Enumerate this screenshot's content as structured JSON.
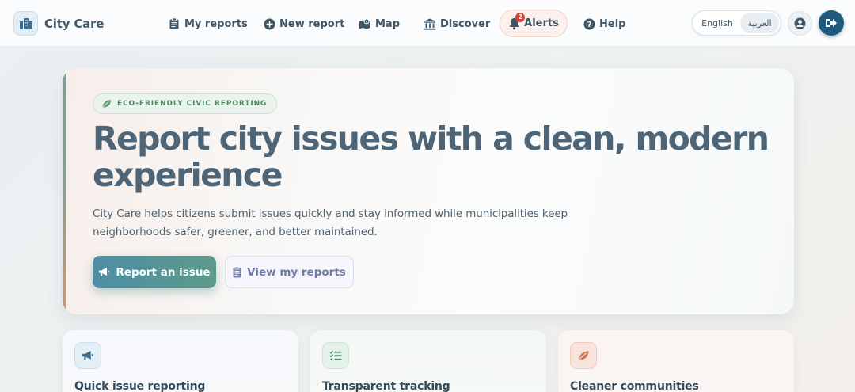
{
  "brand": {
    "name": "City Care",
    "icon": "city-buildings-icon"
  },
  "nav": {
    "links": [
      {
        "label": "My reports",
        "icon": "clipboard-icon"
      },
      {
        "label": "New report",
        "icon": "plus-circle-icon"
      },
      {
        "label": "Map",
        "icon": "map-icon"
      },
      {
        "label": "Discover",
        "icon": "landmark-icon"
      }
    ],
    "alerts": {
      "label": "Alerts",
      "count": "2",
      "icon": "bell-icon"
    },
    "help": {
      "label": "Help",
      "icon": "question-circle-icon"
    },
    "languages": {
      "english": "English",
      "arabic": "العربية",
      "selected": "العربية"
    },
    "profile_icon": "user-circle-icon",
    "logout_icon": "sign-out-icon"
  },
  "hero": {
    "badge": "ECO-FRIENDLY CIVIC REPORTING",
    "badge_icon": "leaf-icon",
    "title": "Report city issues with a clean, modern experience",
    "subtitle": "City Care helps citizens submit issues quickly and stay informed while municipalities keep neighborhoods safer, greener, and better maintained.",
    "primary_button": "Report an issue",
    "primary_icon": "megaphone-icon",
    "secondary_button": "View my reports",
    "secondary_icon": "clipboard-icon"
  },
  "features": [
    {
      "title": "Quick issue reporting",
      "icon": "megaphone-icon"
    },
    {
      "title": "Transparent tracking",
      "icon": "list-check-icon"
    },
    {
      "title": "Cleaner communities",
      "icon": "leaf-icon"
    }
  ],
  "colors": {
    "accent_blue": "#1e5a7e",
    "primary_gradient_start": "#4d8ea6",
    "primary_gradient_end": "#5e9a8a",
    "eco_green": "#4d8a62",
    "alert_red": "#d6453d"
  }
}
